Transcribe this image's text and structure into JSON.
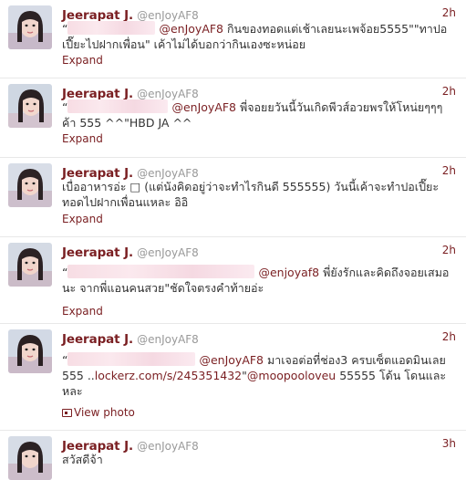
{
  "tweets": [
    {
      "name": "Jeerapat J.",
      "handle": "@enJoyAF8",
      "time": "2h",
      "pre": "“",
      "mention": "@enJoyAF8",
      "text_a": " กินของทอดแต่เช้าเลยนะเพจ้อย5555\"\"ทาปอเปี๊ยะไปฝากเพื่อน\" เค้าไม่ได้บอกว่ากินเองซะหน่อย",
      "action": "Expand"
    },
    {
      "name": "Jeerapat J.",
      "handle": "@enJoyAF8",
      "time": "2h",
      "pre": "“",
      "mention": "@enJoyAF8",
      "text_a": " พี่จอยยวันนี้วันเกิดพีวส์อวยพรให้โหน่ยๆๆๆค้า 555 ^^\"HBD JA ^^",
      "action": "Expand"
    },
    {
      "name": "Jeerapat J.",
      "handle": "@enJoyAF8",
      "time": "2h",
      "text_a": "เบื่ออาหารอ่ะ □ (แต่นังคิดอยู่ว่าจะทำไรกินดี 555555) วันนี้เค้าจะทำปอเปี๊ยะทอดไปฝากเพื่อนแหละ อิอิ",
      "action": "Expand"
    },
    {
      "name": "Jeerapat J.",
      "handle": "@enJoyAF8",
      "time": "2h",
      "pre": "“",
      "mention": "@enjoyaf8",
      "text_a": " พี่ยังรักและคิดถึงจอยเสมอนะ จากพี่แอนคนสวย\"ชัดใจตรงคำท้ายอ่ะ",
      "action": "Expand"
    },
    {
      "name": "Jeerapat J.",
      "handle": "@enJoyAF8",
      "time": "2h",
      "pre": "“",
      "mention": "@enJoyAF8",
      "text_a": " มาเจอต่อที่ช่อง3 ครบเซ็ตแอดมินเลย 555 ..",
      "link": "lockerz.com/s/245351432",
      "text_b": "\"",
      "mention2": "@moopooloveu",
      "text_c": " 55555 โด้น โดนและหละ",
      "action": "View photo"
    },
    {
      "name": "Jeerapat J.",
      "handle": "@enJoyAF8",
      "time": "3h",
      "text_a": "สวัสดีจ้า"
    }
  ],
  "colors": {
    "accent": "#7a1f22",
    "handle": "#999999",
    "text": "#333333"
  }
}
